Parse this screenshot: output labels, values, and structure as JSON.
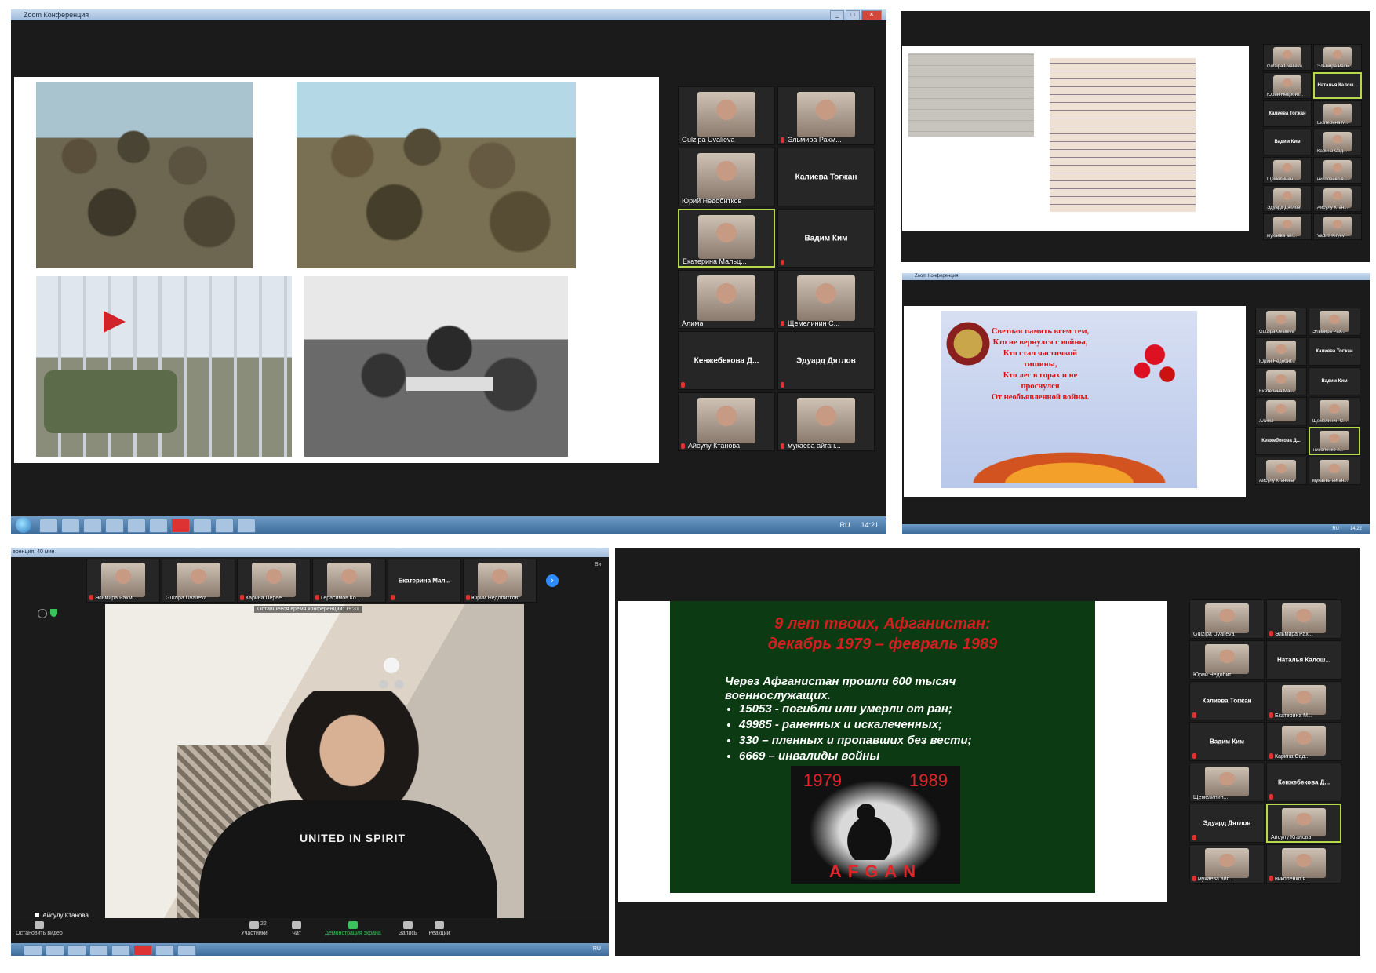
{
  "panel1": {
    "window_title": "Zoom Конференция",
    "window_buttons": [
      "_",
      "□",
      "✕"
    ],
    "participants": [
      {
        "name": "Gulzipa Uvalieva",
        "video": true
      },
      {
        "name": "Эльмира Рахм...",
        "video": true
      },
      {
        "name": "Юрий Недобитков",
        "video": true
      },
      {
        "name": "Калиева Тогжан",
        "video": false
      },
      {
        "name": "Екатерина Мальц...",
        "video": true,
        "active": true
      },
      {
        "name": "Вадим Ким",
        "video": false
      },
      {
        "name": "Алима",
        "video": true
      },
      {
        "name": "Щемелинин С...",
        "video": true
      },
      {
        "name": "Кенжебекова Д...",
        "video": false
      },
      {
        "name": "Эдуард Дятлов",
        "video": false
      },
      {
        "name": "Айсулу Ктанова",
        "video": true
      },
      {
        "name": "мукаева айган...",
        "video": true
      }
    ],
    "taskbar": {
      "lang": "RU",
      "time": "14:21"
    }
  },
  "panel2": {
    "participants": [
      {
        "name": "Gulzipa Uvalieva",
        "video": true
      },
      {
        "name": "Эльмира Рахм...",
        "video": true
      },
      {
        "name": "Юрий Недобит...",
        "video": true
      },
      {
        "name": "Наталья Калош...",
        "video": false,
        "active": true
      },
      {
        "name": "Калиева Тогжан",
        "video": false
      },
      {
        "name": "Екатерина М...",
        "video": true
      },
      {
        "name": "Вадим Ким",
        "video": false
      },
      {
        "name": "Карина Сад...",
        "video": true
      },
      {
        "name": "Щемелинин...",
        "video": true
      },
      {
        "name": "николенко я...",
        "video": true
      },
      {
        "name": "Эдуард Дятлов",
        "video": true
      },
      {
        "name": "Айсулу Ктан...",
        "video": true
      },
      {
        "name": "мукаева айг...",
        "video": true
      },
      {
        "name": "Vadim Kiryev",
        "video": true
      }
    ]
  },
  "panel3": {
    "window_title": "Zoom Конференция",
    "poem": "Светлая память всем тем,\nКто не вернулся с войны,\nКто стал частичкой тишины,\nКто лег в горах и не проснулся\nОт необъявленной войны.",
    "participants": [
      {
        "name": "Gulzipa Uvalieva",
        "video": true
      },
      {
        "name": "Эльмира Рах...",
        "video": true
      },
      {
        "name": "Юрий Недобит...",
        "video": true
      },
      {
        "name": "Калиева Тогжан",
        "video": false
      },
      {
        "name": "Екатерина Ма...",
        "video": true
      },
      {
        "name": "Вадим Ким",
        "video": false
      },
      {
        "name": "Алима",
        "video": true
      },
      {
        "name": "Щемелинин С...",
        "video": true
      },
      {
        "name": "Кенжебекова Д...",
        "video": false
      },
      {
        "name": "николенко я...",
        "video": true,
        "active": true
      },
      {
        "name": "Айсулу Ктанова",
        "video": true
      },
      {
        "name": "мукаева айган...",
        "video": true
      }
    ],
    "taskbar": {
      "lang": "RU",
      "time": "14:22"
    }
  },
  "panel4": {
    "window_title": "еренция, 40 мин",
    "strip": [
      {
        "name": "Эльмира Рахм...",
        "video": true
      },
      {
        "name": "Gulzipa Uvalieva",
        "video": true
      },
      {
        "name": "Карина Перее...",
        "video": true
      },
      {
        "name": "Герасимов Ко...",
        "video": true
      },
      {
        "name": "Екатерина  Мал...",
        "video": false
      },
      {
        "name": "Юрий Недобитков",
        "video": true
      }
    ],
    "strip_right_label": "Ви",
    "timer_text": "Оставшееся время конференции: 19:31",
    "speaker_name": "Айсулу Ктанова",
    "shirt_text": "UNITED IN SPIRIT",
    "toolbar": {
      "stop_video": "Остановить видео",
      "participants": "Участники",
      "participants_count": "22",
      "chat": "Чат",
      "share": "Демонстрация экрана",
      "record": "Запись",
      "reactions": "Реакции"
    },
    "taskbar": {
      "lang": "RU"
    }
  },
  "panel5": {
    "slide_title_line1": "9 лет твоих, Афганистан:",
    "slide_title_line2": "декабрь 1979 – февраль 1989",
    "intro_line1": "Через Афганистан прошли 600 тысяч",
    "intro_line2": "военнослужащих.",
    "bullets": [
      "15053  - погибли или умерли от ран;",
      "49985 -  раненных и искалеченных;",
      "330 – пленных и пропавших без вести;",
      "6669 – инвалиды войны"
    ],
    "year_left": "1979",
    "year_right": "1989",
    "afgan": "AFGAN",
    "participants": [
      {
        "name": "Gulzipa Uvalieva",
        "video": true
      },
      {
        "name": "Эльмира Рах...",
        "video": true
      },
      {
        "name": "Юрий Недобит...",
        "video": true
      },
      {
        "name": "Наталья  Калош...",
        "video": false
      },
      {
        "name": "Калиева Тогжан",
        "video": false
      },
      {
        "name": "Екатерина М...",
        "video": true
      },
      {
        "name": "Вадим Ким",
        "video": false
      },
      {
        "name": "Карина Сад...",
        "video": true
      },
      {
        "name": "Щемелинин...",
        "video": true
      },
      {
        "name": "Кенжебекова  Д...",
        "video": false
      },
      {
        "name": "Эдуард Дятлов",
        "video": false
      },
      {
        "name": "Айсулу Ктанова",
        "video": true,
        "active": true
      },
      {
        "name": "мукаева айг...",
        "video": true
      },
      {
        "name": "николенко я...",
        "video": true
      }
    ]
  },
  "colors": {
    "zoom_bg": "#1b1b1b",
    "active_border": "#b6d84b",
    "slide_red": "#d21f1f",
    "slide_green": "#0c3a12",
    "zoom_blue": "#2d8cff",
    "share_green": "#39c35a"
  }
}
